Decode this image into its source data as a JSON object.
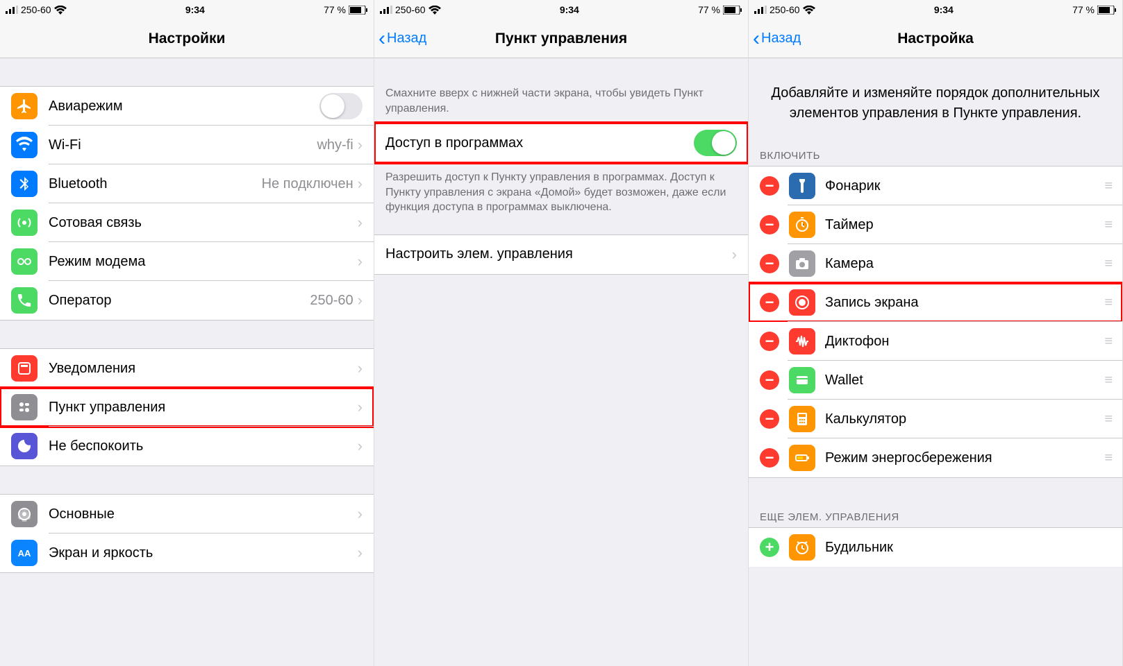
{
  "status": {
    "carrier": "250-60",
    "time": "9:34",
    "battery": "77 %"
  },
  "screen1": {
    "title": "Настройки",
    "group1": [
      {
        "icon": "airplane",
        "color": "ic-orange",
        "label": "Авиарежим",
        "kind": "toggle",
        "on": false
      },
      {
        "icon": "wifi",
        "color": "ic-blue",
        "label": "Wi-Fi",
        "value": "why-fi",
        "kind": "link"
      },
      {
        "icon": "bluetooth",
        "color": "ic-blue",
        "label": "Bluetooth",
        "value": "Не подключен",
        "kind": "link"
      },
      {
        "icon": "antenna",
        "color": "ic-green",
        "label": "Сотовая связь",
        "kind": "link"
      },
      {
        "icon": "hotspot",
        "color": "ic-green",
        "label": "Режим модема",
        "kind": "link"
      },
      {
        "icon": "phone",
        "color": "ic-green",
        "label": "Оператор",
        "value": "250-60",
        "kind": "link"
      }
    ],
    "group2": [
      {
        "icon": "notifications",
        "color": "ic-red",
        "label": "Уведомления",
        "kind": "link"
      },
      {
        "icon": "controlcenter",
        "color": "ic-gray",
        "label": "Пункт управления",
        "kind": "link",
        "highlight": true
      },
      {
        "icon": "dnd",
        "color": "ic-purple",
        "label": "Не беспокоить",
        "kind": "link"
      }
    ],
    "group3": [
      {
        "icon": "general",
        "color": "ic-gray",
        "label": "Основные",
        "kind": "link"
      },
      {
        "icon": "display",
        "color": "ic-dblue",
        "label": "Экран и яркость",
        "kind": "link"
      }
    ]
  },
  "screen2": {
    "back": "Назад",
    "title": "Пункт управления",
    "desc1": "Смахните вверх с нижней части экрана, чтобы увидеть Пункт управления.",
    "access_label": "Доступ в программах",
    "access_on": true,
    "desc2": "Разрешить доступ к Пункту управления в программах. Доступ к Пункту управления с экрана «Домой» будет возможен, даже если функция доступа в программах выключена.",
    "customize_label": "Настроить элем. управления"
  },
  "screen3": {
    "back": "Назад",
    "title": "Настройка",
    "desc": "Добавляйте и изменяйте порядок дополнительных элементов управления в Пункте управления.",
    "include_header": "ВКЛЮЧИТЬ",
    "included": [
      {
        "icon": "flashlight",
        "color": "ic-navy",
        "label": "Фонарик"
      },
      {
        "icon": "timer",
        "color": "ic-orange",
        "label": "Таймер"
      },
      {
        "icon": "camera",
        "color": "ic-gray2",
        "label": "Камера"
      },
      {
        "icon": "record",
        "color": "ic-red",
        "label": "Запись экрана",
        "highlight": true
      },
      {
        "icon": "voice",
        "color": "ic-red",
        "label": "Диктофон"
      },
      {
        "icon": "wallet",
        "color": "ic-green",
        "label": "Wallet"
      },
      {
        "icon": "calc",
        "color": "ic-orange",
        "label": "Калькулятор"
      },
      {
        "icon": "lowpower",
        "color": "ic-orange",
        "label": "Режим энергосбережения"
      }
    ],
    "more_header": "ЕЩЕ ЭЛЕМ. УПРАВЛЕНИЯ",
    "more": [
      {
        "icon": "alarm",
        "color": "ic-orange",
        "label": "Будильник"
      }
    ]
  }
}
